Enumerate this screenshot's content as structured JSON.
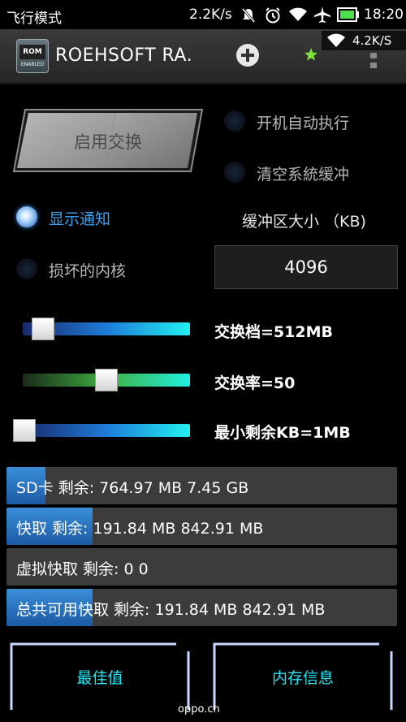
{
  "statusbar": {
    "airplane_mode": "飞行模式",
    "net_speed": "2.2K/s",
    "time": "18:20",
    "icons": [
      "mute-icon",
      "alarm-icon",
      "wifi-icon",
      "airplane-icon",
      "battery-icon"
    ]
  },
  "actionbar": {
    "title": "ROEHSOFT RA.",
    "logo_text": "ROM",
    "logo_sub": "ENABLED",
    "net_overlay_speed": "4.2K/S"
  },
  "main": {
    "enable_button": "启用交换",
    "options": [
      {
        "label": "开机自动执行",
        "checked": false
      },
      {
        "label": "清空系統缓冲",
        "checked": false
      },
      {
        "label": "显示通知",
        "checked": true
      },
      {
        "label": "损坏的内核",
        "checked": false
      }
    ],
    "buffer": {
      "label": "缓冲区大小 （KB)",
      "value": "4096"
    },
    "sliders": [
      {
        "label": "交换档=512MB",
        "level": 0.12
      },
      {
        "label": "交换率=50",
        "level": 0.5
      },
      {
        "label": "最小剩余KB=1MB",
        "level": 0.0
      }
    ],
    "info_bars": [
      {
        "text": "SD卡 剩余: 764.97 MB 7.45 GB",
        "level": 0.1
      },
      {
        "text": "快取 剩余: 191.84 MB 842.91 MB",
        "level": 0.22
      },
      {
        "text": "虚拟快取 剩余: 0 0",
        "level": 0.0
      },
      {
        "text": "总共可用快取 剩余: 191.84 MB 842.91 MB",
        "level": 0.22
      }
    ]
  },
  "bottom": {
    "best_button": "最佳值",
    "memory_button": "内存信息"
  },
  "watermark": "oppo.cn",
  "colors": {
    "accent_blue": "#3fa2f2",
    "button_text_cyan": "#29e4f2",
    "bar_fill": "#2a74c4"
  }
}
